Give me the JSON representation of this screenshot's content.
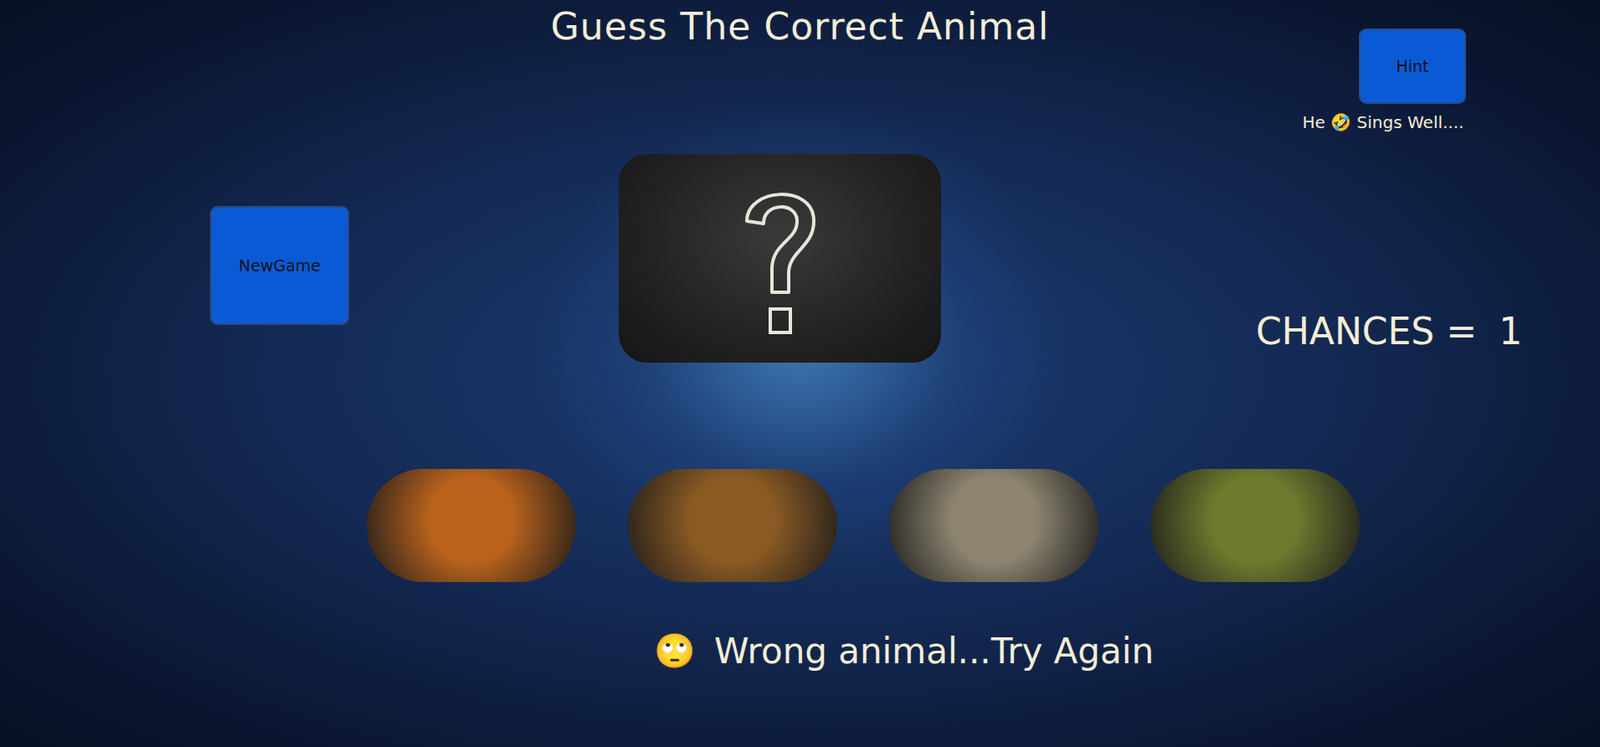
{
  "title": "Guess The Correct Animal",
  "hint": {
    "button": "Hint",
    "text": "He 🤣 Sings Well...."
  },
  "new_game": {
    "button": "NewGame"
  },
  "chances": {
    "label": "CHANCES =",
    "value": "1"
  },
  "choices": [
    {
      "color": "#b8621c"
    },
    {
      "color": "#8a5a24"
    },
    {
      "color": "#8d8470"
    },
    {
      "color": "#6f7a2e"
    }
  ],
  "message": {
    "emoji": "🙄",
    "text": "Wrong animal...Try Again"
  }
}
